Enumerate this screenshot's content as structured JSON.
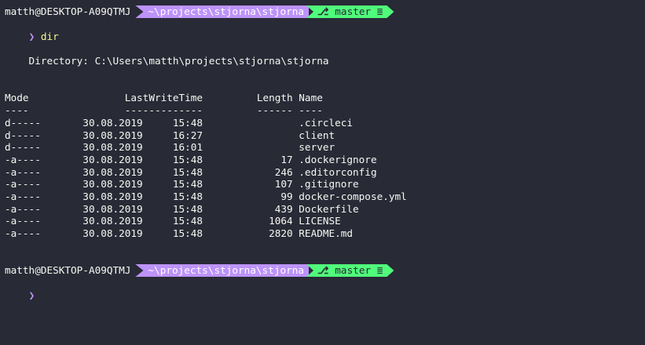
{
  "prompts": [
    {
      "user": "matth@DESKTOP-A09QTMJ",
      "path": "~\\projects\\stjorna\\stjorna",
      "branch_icon": "⎇",
      "branch": "master",
      "status_icon": "≣",
      "chevron": "❯",
      "command": "dir"
    },
    {
      "user": "matth@DESKTOP-A09QTMJ",
      "path": "~\\projects\\stjorna\\stjorna",
      "branch_icon": "⎇",
      "branch": "master",
      "status_icon": "≣",
      "chevron": "❯",
      "command": ""
    }
  ],
  "directory_line": "    Directory: C:\\Users\\matth\\projects\\stjorna\\stjorna",
  "table": {
    "header": "Mode                LastWriteTime         Length Name",
    "separator": "----                -------------         ------ ----",
    "rows": [
      "d-----       30.08.2019     15:48                .circleci",
      "d-----       30.08.2019     16:27                client",
      "d-----       30.08.2019     16:01                server",
      "-a----       30.08.2019     15:48             17 .dockerignore",
      "-a----       30.08.2019     15:48            246 .editorconfig",
      "-a----       30.08.2019     15:48            107 .gitignore",
      "-a----       30.08.2019     15:48             99 docker-compose.yml",
      "-a----       30.08.2019     15:48            439 Dockerfile",
      "-a----       30.08.2019     15:48           1064 LICENSE",
      "-a----       30.08.2019     15:48           2820 README.md"
    ]
  },
  "colors": {
    "background": "#282a36",
    "foreground": "#f8f8f2",
    "path_segment": "#bd93f9",
    "git_segment": "#50fa7b",
    "command": "#f1fa8c"
  }
}
